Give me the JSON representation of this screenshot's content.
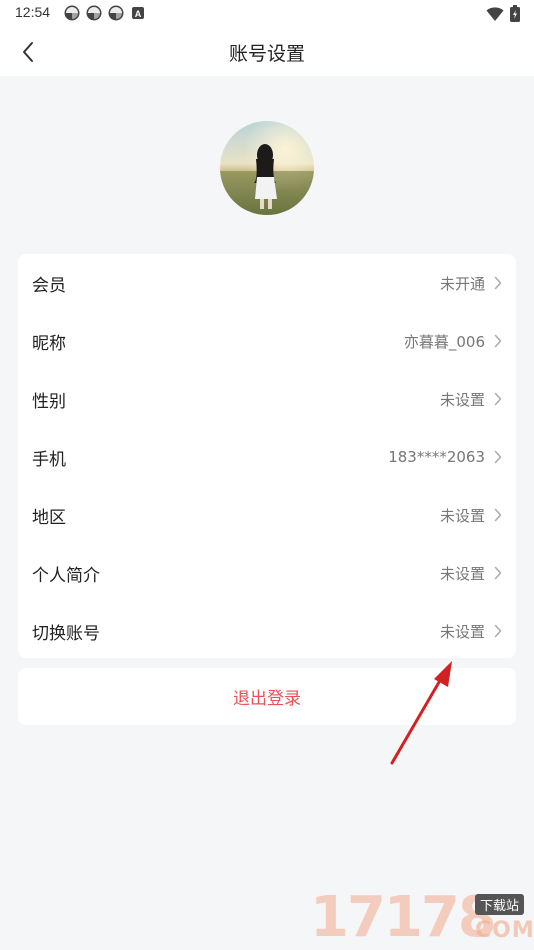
{
  "status_bar": {
    "time": "12:54",
    "notification_icons": [
      "pinwheel-icon",
      "pinwheel-icon",
      "pinwheel-icon",
      "a-badge-icon"
    ],
    "right_icons": [
      "wifi-icon",
      "battery-icon"
    ]
  },
  "nav": {
    "title": "账号设置",
    "back_icon": "chevron-left-icon"
  },
  "profile": {
    "avatar_icon": "avatar-photo"
  },
  "settings": {
    "items": [
      {
        "label": "会员",
        "value": "未开通"
      },
      {
        "label": "昵称",
        "value": "亦暮暮_006"
      },
      {
        "label": "性别",
        "value": "未设置"
      },
      {
        "label": "手机",
        "value": "183****2063"
      },
      {
        "label": "地区",
        "value": "未设置"
      },
      {
        "label": "个人简介",
        "value": "未设置"
      },
      {
        "label": "切换账号",
        "value": "未设置"
      }
    ]
  },
  "logout": {
    "label": "退出登录",
    "color": "#ef4f55"
  },
  "watermark": {
    "digits": "17178",
    "tag": "下载站",
    "suffix": "COM"
  },
  "colors": {
    "background": "#f5f6f8",
    "card": "#ffffff",
    "annotation_arrow": "#d42020"
  }
}
